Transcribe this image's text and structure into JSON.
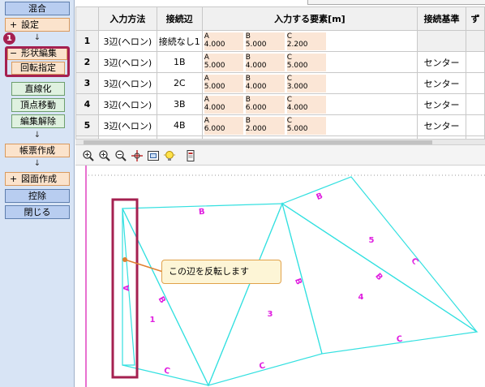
{
  "left_panel": {
    "mixed": "混合",
    "settings": "設定",
    "shape_edit": "形状編集",
    "rotate_spec": "回転指定",
    "straighten": "直線化",
    "vertex_move": "頂点移動",
    "edit_release": "編集解除",
    "form_create": "帳票作成",
    "drawing_create": "図面作成",
    "remove": "控除",
    "close": "閉じる",
    "plus": "+",
    "minus": "−",
    "down_arrow": "↓",
    "step_number": "1"
  },
  "table": {
    "headers": [
      "入力方法",
      "接続辺",
      "入力する要素[m]",
      "接続基準",
      "ず"
    ],
    "rows": [
      {
        "num": "1",
        "method": "3辺(ヘロン)",
        "edge": "接続なし1",
        "elements": [
          [
            "A",
            "4.000"
          ],
          [
            "B",
            "5.000"
          ],
          [
            "C",
            "2.200"
          ]
        ],
        "base": ""
      },
      {
        "num": "2",
        "method": "3辺(ヘロン)",
        "edge": "1B",
        "elements": [
          [
            "A",
            "5.000"
          ],
          [
            "B",
            "4.000"
          ],
          [
            "C",
            "5.000"
          ]
        ],
        "base": "センター"
      },
      {
        "num": "3",
        "method": "3辺(ヘロン)",
        "edge": "2C",
        "elements": [
          [
            "A",
            "5.000"
          ],
          [
            "B",
            "4.000"
          ],
          [
            "C",
            "3.000"
          ]
        ],
        "base": "センター"
      },
      {
        "num": "4",
        "method": "3辺(ヘロン)",
        "edge": "3B",
        "elements": [
          [
            "A",
            "4.000"
          ],
          [
            "B",
            "6.000"
          ],
          [
            "C",
            "4.000"
          ]
        ],
        "base": "センター"
      },
      {
        "num": "5",
        "method": "3辺(ヘロン)",
        "edge": "4B",
        "elements": [
          [
            "A",
            "6.000"
          ],
          [
            "B",
            "2.000"
          ],
          [
            "C",
            "5.000"
          ]
        ],
        "base": "センター"
      }
    ]
  },
  "toolbar": {
    "icons": [
      "zoom-in-icon",
      "zoom-in-plus-icon",
      "zoom-out-icon",
      "pan-icon",
      "fit-icon",
      "bulb-icon",
      "print-icon"
    ]
  },
  "drawing": {
    "callout_text": "この辺を反転します",
    "labels": {
      "A": "A",
      "B": "B",
      "C": "C",
      "n1": "1",
      "n3": "3",
      "n4": "4",
      "n5": "5"
    },
    "line_color": "#33e0e0",
    "label_color": "#e020e0",
    "highlight_color": "#a52050"
  }
}
